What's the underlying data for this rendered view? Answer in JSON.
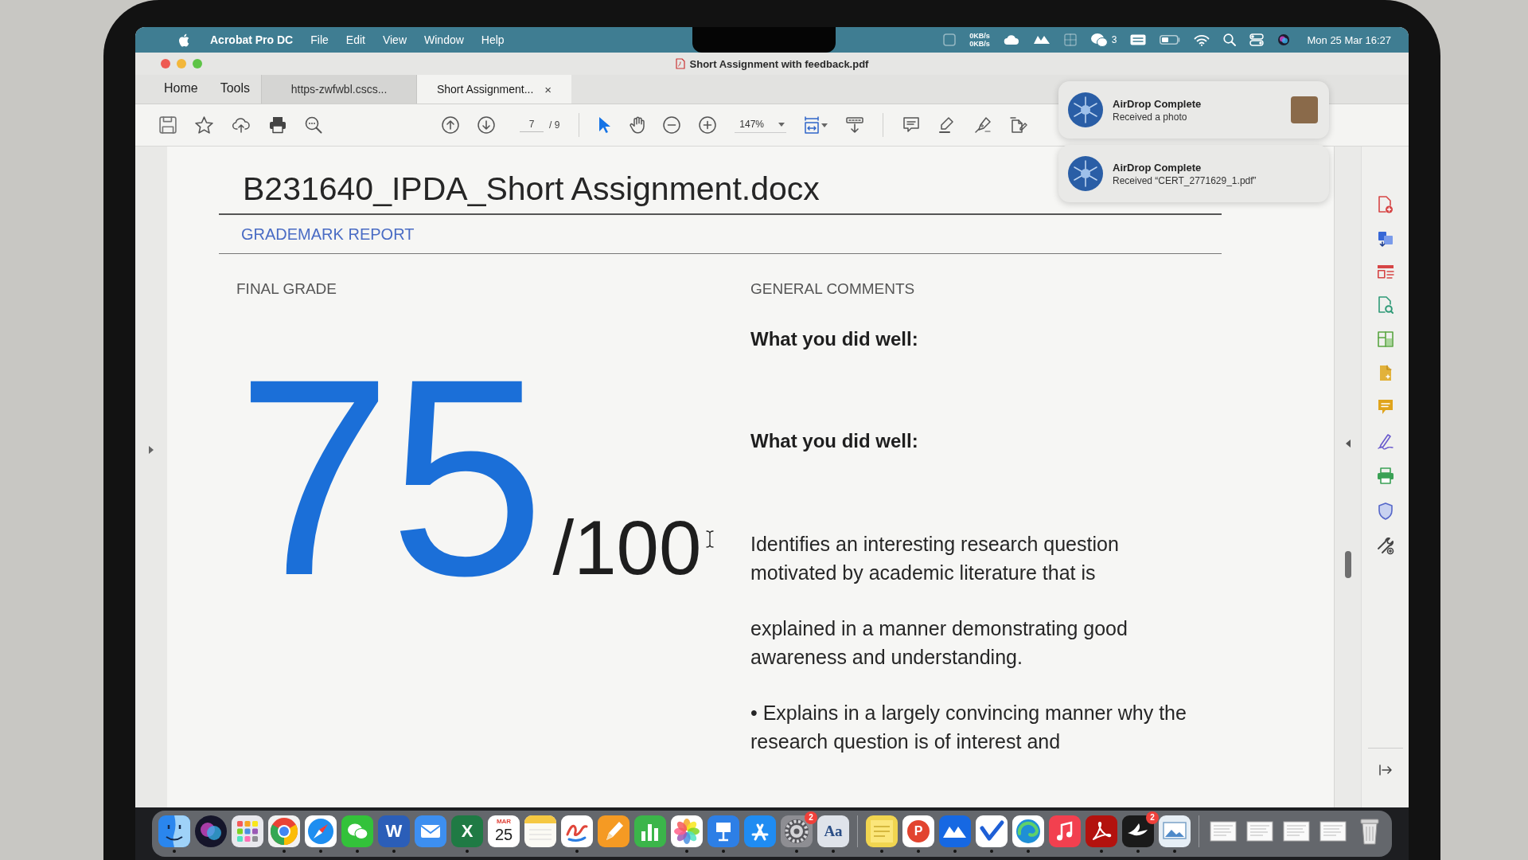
{
  "menu_bar": {
    "app_name": "Acrobat Pro DC",
    "menus": [
      "File",
      "Edit",
      "View",
      "Window",
      "Help"
    ],
    "network_speed": [
      "0KB/s",
      "0KB/s"
    ],
    "chat_count": "3",
    "clock": "Mon 25 Mar 16:27"
  },
  "window": {
    "title": "Short Assignment with feedback.pdf"
  },
  "tabs": [
    {
      "kind": "nav",
      "label": "Home",
      "selected": false
    },
    {
      "kind": "nav",
      "label": "Tools",
      "selected": false
    },
    {
      "kind": "document",
      "label": "https-zwfwbl.cscs...",
      "selected": false
    },
    {
      "kind": "document",
      "label": "Short Assignment...",
      "selected": true,
      "close": "×"
    }
  ],
  "toolbar": {
    "page": {
      "current": "7",
      "total": "/ 9"
    },
    "tool_modes": [
      {
        "kind": "pointer",
        "selected": true
      },
      {
        "kind": "hand",
        "selected": false
      }
    ],
    "zoom": "147%"
  },
  "notifications": [
    {
      "title": "AirDrop Complete",
      "body": "Received a photo",
      "thumbnail": true
    },
    {
      "title": "AirDrop Complete",
      "body": "Received “CERT_2771629_1.pdf”",
      "thumbnail": false
    }
  ],
  "document": {
    "title": "B231640_IPDA_Short Assignment.docx",
    "report_label": "GRADEMARK REPORT",
    "final_grade": {
      "label": "FINAL GRADE",
      "score": "75",
      "out_of": "/100"
    },
    "general_comments": {
      "label": "GENERAL COMMENTS",
      "blocks": [
        {
          "kind": "heading",
          "lines": [
            "What you did well:"
          ]
        },
        {
          "kind": "heading",
          "lines": [
            "What you did well:"
          ]
        },
        {
          "kind": "paragraph",
          "lines": [
            "Identifies an interesting research question",
            "motivated by academic literature that is"
          ]
        },
        {
          "kind": "paragraph",
          "lines": [
            "explained in a manner demonstrating good",
            "awareness and understanding."
          ]
        },
        {
          "kind": "paragraph",
          "lines": [
            "• Explains in a largely convincing manner why the",
            "research question is of interest and"
          ]
        }
      ]
    }
  },
  "dock": [
    {
      "kind": "face",
      "running": true
    },
    {
      "kind": "orb",
      "running": false
    },
    {
      "kind": "grid",
      "running": false
    },
    {
      "kind": "wheel",
      "running": true
    },
    {
      "kind": "compass",
      "running": true
    },
    {
      "kind": "chat",
      "running": true
    },
    {
      "kind": "doc_letter",
      "glyph": "W",
      "running": true
    },
    {
      "kind": "envelope",
      "running": false
    },
    {
      "kind": "sheet_letter",
      "glyph": "X",
      "running": true
    },
    {
      "kind": "calendar",
      "month": "MAR",
      "day": "25",
      "running": false
    },
    {
      "kind": "note",
      "running": false
    },
    {
      "kind": "squiggle",
      "running": true
    },
    {
      "kind": "pencil",
      "running": false
    },
    {
      "kind": "bars",
      "running": false
    },
    {
      "kind": "flower",
      "running": true
    },
    {
      "kind": "podium",
      "running": true
    },
    {
      "kind": "appstore",
      "running": false
    },
    {
      "kind": "gear",
      "badge": "2",
      "running": true
    },
    {
      "kind": "dictionary",
      "glyph": "Aa",
      "running": true
    },
    {
      "kind": "separator"
    },
    {
      "kind": "sticky",
      "running": true
    },
    {
      "kind": "pcircle",
      "glyph": "P",
      "running": true
    },
    {
      "kind": "peaks",
      "running": true
    },
    {
      "kind": "check",
      "running": true
    },
    {
      "kind": "swirl",
      "running": true
    },
    {
      "kind": "music",
      "running": false
    },
    {
      "kind": "acrobat",
      "running": true
    },
    {
      "kind": "bird",
      "badge": "2",
      "running": true
    },
    {
      "kind": "preview",
      "running": true
    },
    {
      "kind": "separator"
    },
    {
      "kind": "document"
    },
    {
      "kind": "document"
    },
    {
      "kind": "document"
    },
    {
      "kind": "document"
    },
    {
      "kind": "trash"
    }
  ]
}
